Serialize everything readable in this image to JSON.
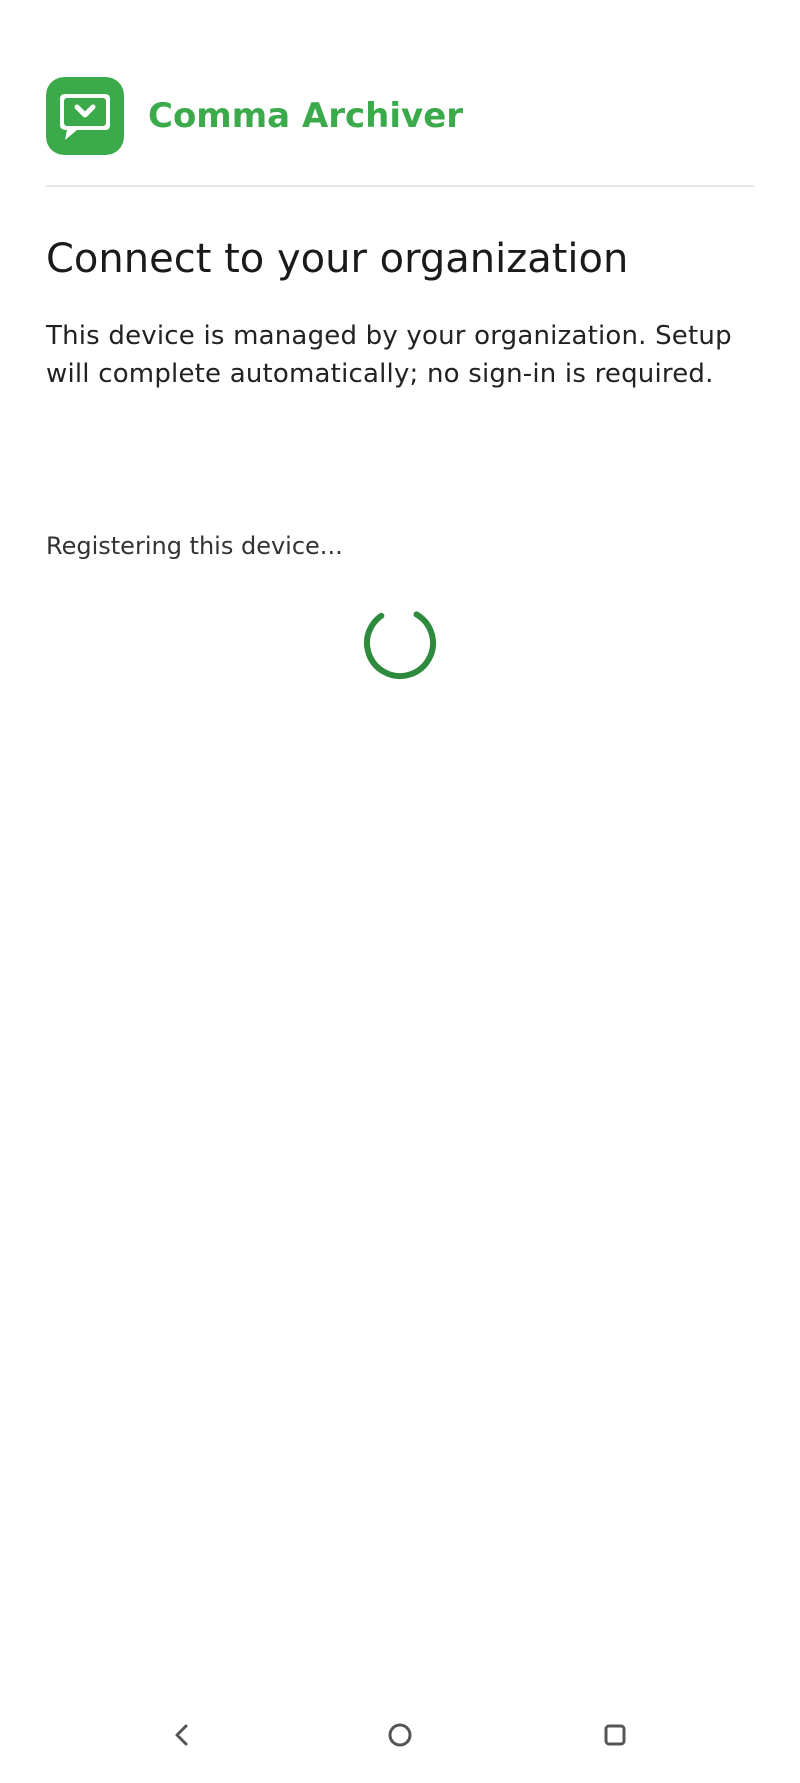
{
  "header": {
    "app_name": "Comma Archiver",
    "logo_icon": "chat-bubble-check-icon"
  },
  "main": {
    "title": "Connect to your organization",
    "description": "This device is managed by your organization. Setup will complete automatically; no sign-in is required.",
    "status": "Registering this device..."
  },
  "nav": {
    "back_icon": "back-chevron-icon",
    "home_icon": "home-circle-icon",
    "recents_icon": "recents-square-icon"
  },
  "colors": {
    "brand": "#3aaa4a",
    "spinner": "#2e8b3e",
    "text": "#1a1a1a",
    "nav_icon": "#555555"
  }
}
